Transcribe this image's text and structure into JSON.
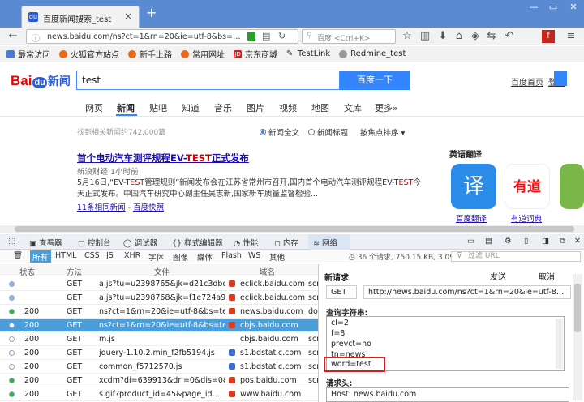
{
  "browser": {
    "tab_title": "百度新闻搜索_test",
    "url": "news.baidu.com/ns?ct=1&rn=20&ie=utf-8&bs=test&",
    "search_placeholder": "百度 <Ctrl+K>"
  },
  "bookmarks": [
    "最常访问",
    "火狐官方站点",
    "新手上路",
    "常用网址",
    "京东商城",
    "TestLink",
    "Redmine_test"
  ],
  "page": {
    "logo_bai": "Bai",
    "logo_du": "du",
    "logo_news": "新闻",
    "search_value": "test",
    "search_button": "百度一下",
    "top_links": [
      "百度首页",
      "登录"
    ],
    "nav_tabs": [
      "网页",
      "新闻",
      "贴吧",
      "知道",
      "音乐",
      "图片",
      "视频",
      "地图",
      "文库",
      "更多»"
    ],
    "result_count": "找到相关新闻约742,000篇",
    "radio_full": "新闻全文",
    "radio_title": "新闻标题",
    "sort_label": "按焦点排序",
    "result": {
      "title_pre": "首个电动汽车测评规程EV-",
      "title_hl": "TEST",
      "title_post": "正式发布",
      "source": "新浪财经  1小时前",
      "text_1": "5月16日,“EV-",
      "text_hl1": "TEST",
      "text_2": "管理规则”新闻发布会在江苏省常州市召开,国内首个电动汽车测评规程EV-T",
      "text_hl2": "EST",
      "text_3": "今天正式发布。中国汽车研究中心副主任吴志新,国家新车质量监督检验...",
      "more": "11条相同新闻",
      "sep": " - ",
      "cache": "百度快照"
    },
    "english_title": "英语翻译",
    "apps": [
      "百度翻译",
      "有道词典"
    ],
    "app_icon_text": [
      "译",
      "有道"
    ]
  },
  "devtools": {
    "tabs": [
      "查看器",
      "控制台",
      "调试器",
      "样式编辑器",
      "性能",
      "内存",
      "网络"
    ],
    "filters": [
      "所有",
      "HTML",
      "CSS",
      "JS",
      "XHR",
      "字体",
      "图像",
      "媒体",
      "Flash",
      "WS",
      "其他"
    ],
    "stats": "36 个请求, 750.15 KB, 3.09 秒",
    "filter_placeholder": "过滤 URL",
    "columns": [
      "状态",
      "方法",
      "文件",
      "域名"
    ],
    "rows": [
      {
        "status": "",
        "method": "GET",
        "file": "a.js?tu=u2398765&jk=d21c3dbd4...",
        "domain": "eclick.baidu.com",
        "type": "scri",
        "dot": "#9bb2d8"
      },
      {
        "status": "",
        "method": "GET",
        "file": "a.js?tu=u2398768&jk=f1e724a9ff...",
        "domain": "eclick.baidu.com",
        "type": "scri",
        "dot": "#9bb2d8"
      },
      {
        "status": "200",
        "method": "GET",
        "file": "ns?ct=1&rn=20&ie=utf-8&bs=te...",
        "domain": "news.baidu.com",
        "type": "doc",
        "dot": "#2db52d"
      },
      {
        "status": "200",
        "method": "GET",
        "file": "ns?ct=1&rn=20&ie=utf-8&bs=te...",
        "domain": "cbjs.baidu.com",
        "type": "",
        "dot": "#ffffff"
      },
      {
        "status": "200",
        "method": "GET",
        "file": "m.js",
        "domain": "cbjs.baidu.com",
        "type": "scri",
        "dot": "#ffffff"
      },
      {
        "status": "200",
        "method": "GET",
        "file": "jquery-1.10.2.min_f2fb5194.js",
        "domain": "s1.bdstatic.com",
        "type": "scri",
        "dot": "#ffffff"
      },
      {
        "status": "200",
        "method": "GET",
        "file": "common_f5712570.js",
        "domain": "s1.bdstatic.com",
        "type": "scri",
        "dot": "#ffffff"
      },
      {
        "status": "200",
        "method": "GET",
        "file": "xcdm?di=639913&dri=0&dis=0&...",
        "domain": "pos.baidu.com",
        "type": "scri",
        "dot": "#2db52d"
      },
      {
        "status": "200",
        "method": "GET",
        "file": "s.gif?product_id=45&page_id...",
        "domain": "www.baidu.com",
        "type": "",
        "dot": "#2db52d"
      }
    ],
    "panel": {
      "title": "新请求",
      "send": "发送",
      "cancel": "取消",
      "method": "GET",
      "url": "http://news.baidu.com/ns?ct=1&rn=20&ie=utf-8&bs=t...",
      "query_label": "查询字符串:",
      "query_lines": [
        "cl=2",
        "f=8",
        "prevct=no",
        "tn=news",
        "word=test"
      ],
      "headers_label": "请求头:",
      "header_value": "Host: news.baidu.com"
    }
  }
}
